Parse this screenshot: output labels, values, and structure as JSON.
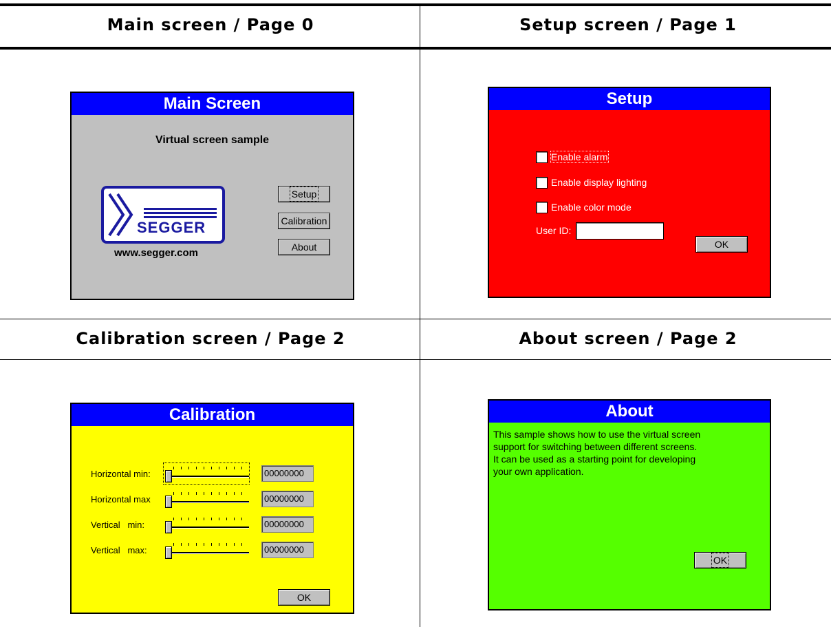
{
  "captions": {
    "main": "Main screen / Page 0",
    "setup": "Setup screen / Page 1",
    "calibration": "Calibration screen / Page 2",
    "about": "About screen / Page 2"
  },
  "colors": {
    "title_bar": "#0000ff",
    "main_bg": "#c0c0c0",
    "setup_bg": "#ff0000",
    "calibration_bg": "#ffff00",
    "about_bg": "#55ff00",
    "logo_blue": "#1a1aa0"
  },
  "main_screen": {
    "title": "Main Screen",
    "subtitle": "Virtual screen sample",
    "logo_text": "SEGGER",
    "url": "www.segger.com",
    "buttons": {
      "setup": "Setup",
      "calibration": "Calibration",
      "about": "About"
    }
  },
  "setup_screen": {
    "title": "Setup",
    "checkboxes": [
      "Enable alarm",
      "Enable display lighting",
      "Enable color mode"
    ],
    "user_id_label": "User ID:",
    "user_id_value": "",
    "ok": "OK"
  },
  "calibration_screen": {
    "title": "Calibration",
    "rows": [
      {
        "label": "Horizontal min:",
        "value": "00000000",
        "level": 0
      },
      {
        "label": "Horizontal max",
        "value": "00000000",
        "level": 0
      },
      {
        "label": "Vertical   min:",
        "value": "00000000",
        "level": 0
      },
      {
        "label": "Vertical   max:",
        "value": "00000000",
        "level": 0
      }
    ],
    "ok": "OK"
  },
  "about_screen": {
    "title": "About",
    "text_lines": [
      "This sample shows how to use the virtual screen",
      "support for switching between different screens.",
      "It can be used as a starting point for developing",
      "your own application."
    ],
    "ok": "OK"
  }
}
